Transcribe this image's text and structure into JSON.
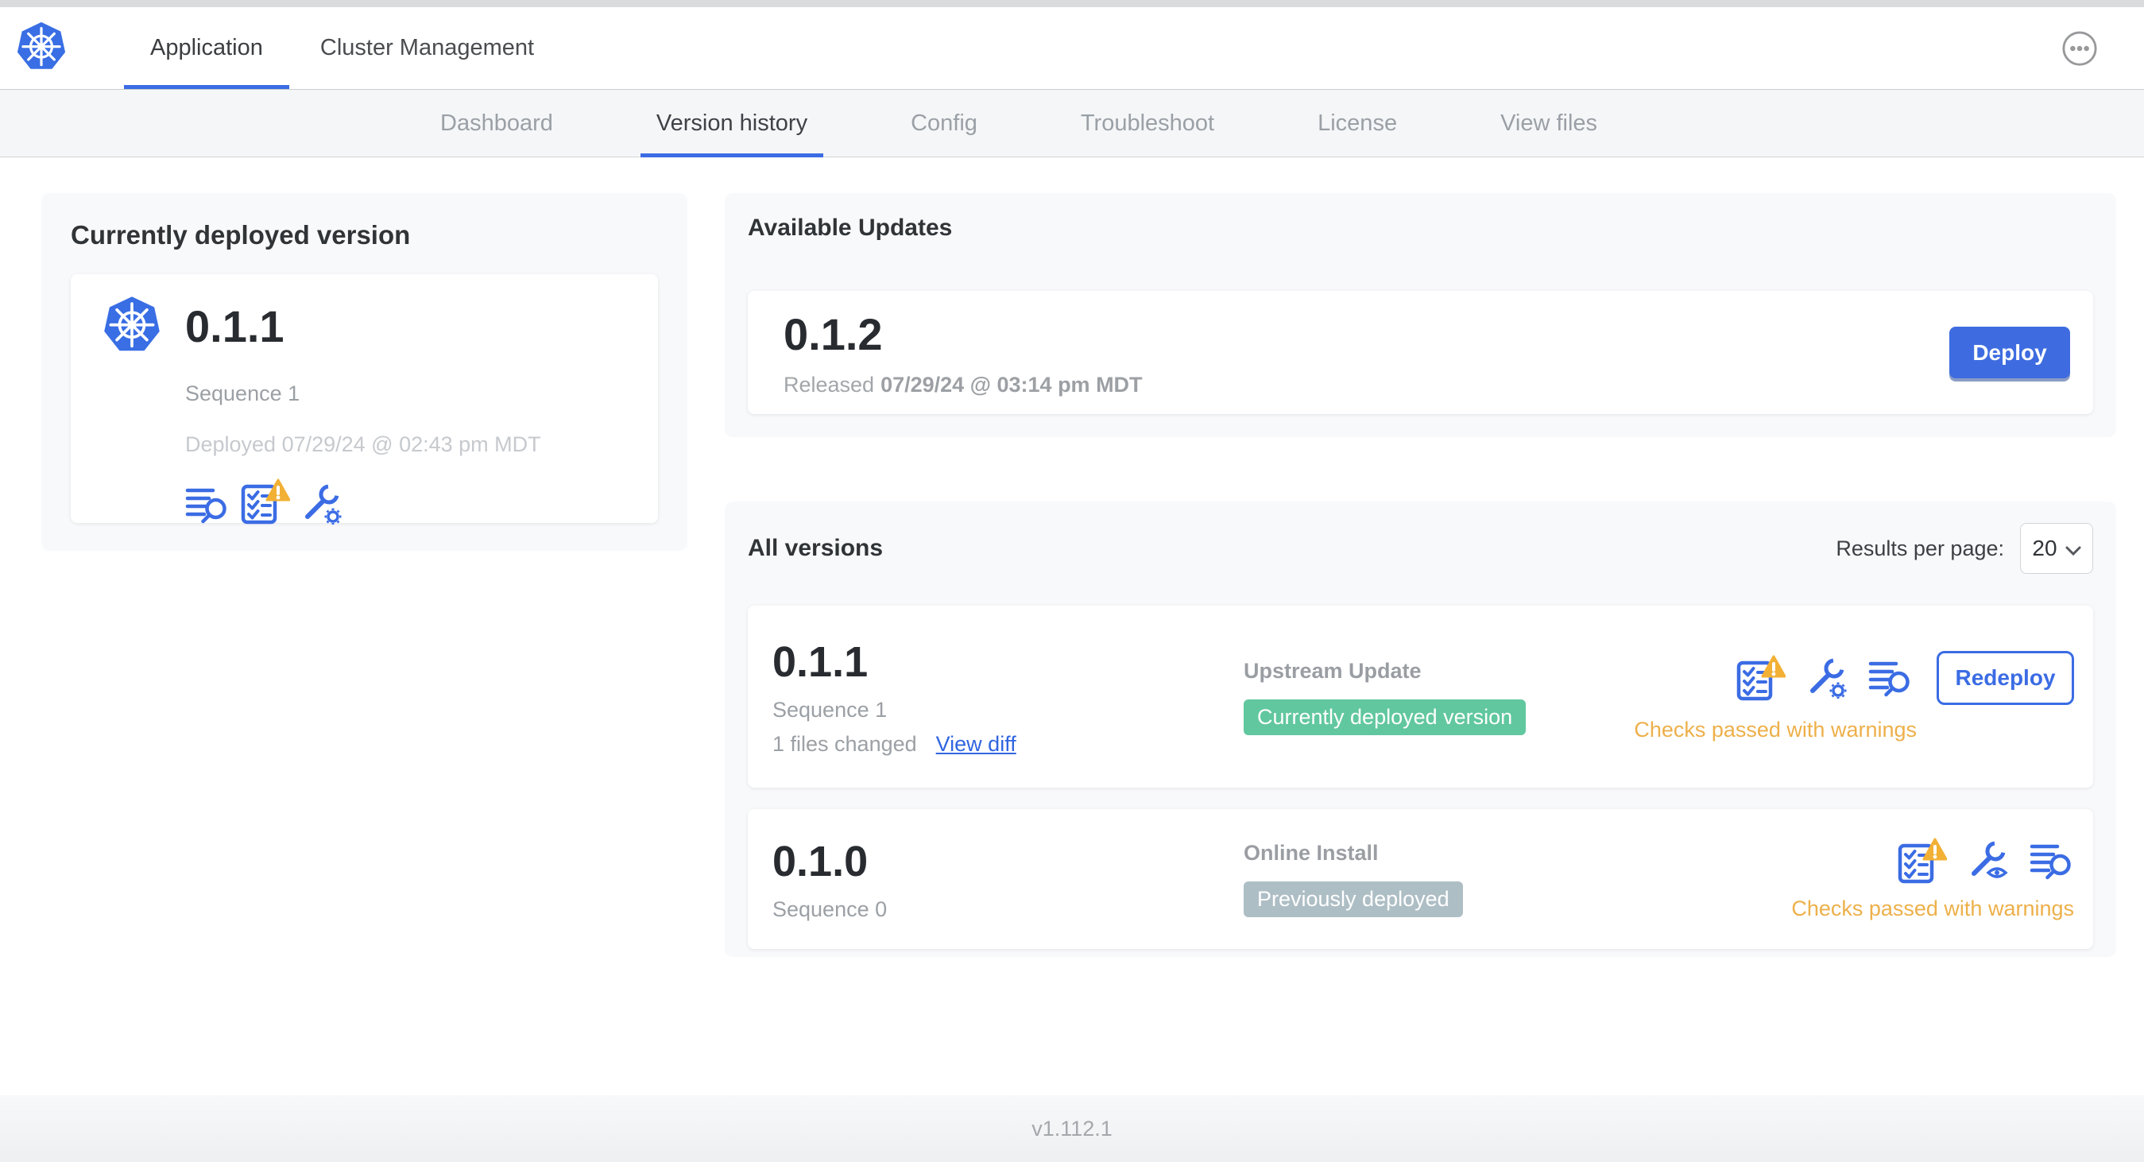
{
  "header": {
    "tabs": [
      {
        "label": "Application"
      },
      {
        "label": "Cluster Management"
      }
    ],
    "active_tab": "Application"
  },
  "subnav": {
    "tabs": [
      {
        "label": "Dashboard"
      },
      {
        "label": "Version history"
      },
      {
        "label": "Config"
      },
      {
        "label": "Troubleshoot"
      },
      {
        "label": "License"
      },
      {
        "label": "View files"
      }
    ],
    "active_tab": "Version history"
  },
  "current_version": {
    "title": "Currently deployed version",
    "version": "0.1.1",
    "sequence": "Sequence 1",
    "deployed": "Deployed 07/29/24 @ 02:43 pm MDT"
  },
  "available_updates": {
    "title": "Available Updates",
    "version": "0.1.2",
    "released_prefix": "Released",
    "released_date": "07/29/24 @ 03:14 pm MDT",
    "deploy_button": "Deploy"
  },
  "all_versions": {
    "title": "All versions",
    "results_per_page_label": "Results per page:",
    "results_per_page": "20",
    "rows": [
      {
        "version": "0.1.1",
        "sequence": "Sequence 1",
        "files_changed": "1 files changed",
        "view_diff": "View diff",
        "source": "Upstream Update",
        "badge": "Currently deployed version",
        "badge_color": "#61c79e",
        "status": "Checks passed with warnings",
        "action": "Redeploy"
      },
      {
        "version": "0.1.0",
        "sequence": "Sequence 0",
        "source": "Online Install",
        "badge": "Previously deployed",
        "badge_color": "#aebec5",
        "status": "Checks passed with warnings"
      }
    ]
  },
  "footer": {
    "app_version": "v1.112.1"
  },
  "colors": {
    "accent_blue": "#3b6ce4",
    "deploy_button_blue": "#3e6ce0",
    "link_blue": "#3065e0",
    "badge_green": "#61c79e",
    "badge_gray": "#aebec5",
    "warning_yellow": "#edb04a",
    "warning_triangle": "#f2b035",
    "logo_blue": "#396ee4"
  }
}
